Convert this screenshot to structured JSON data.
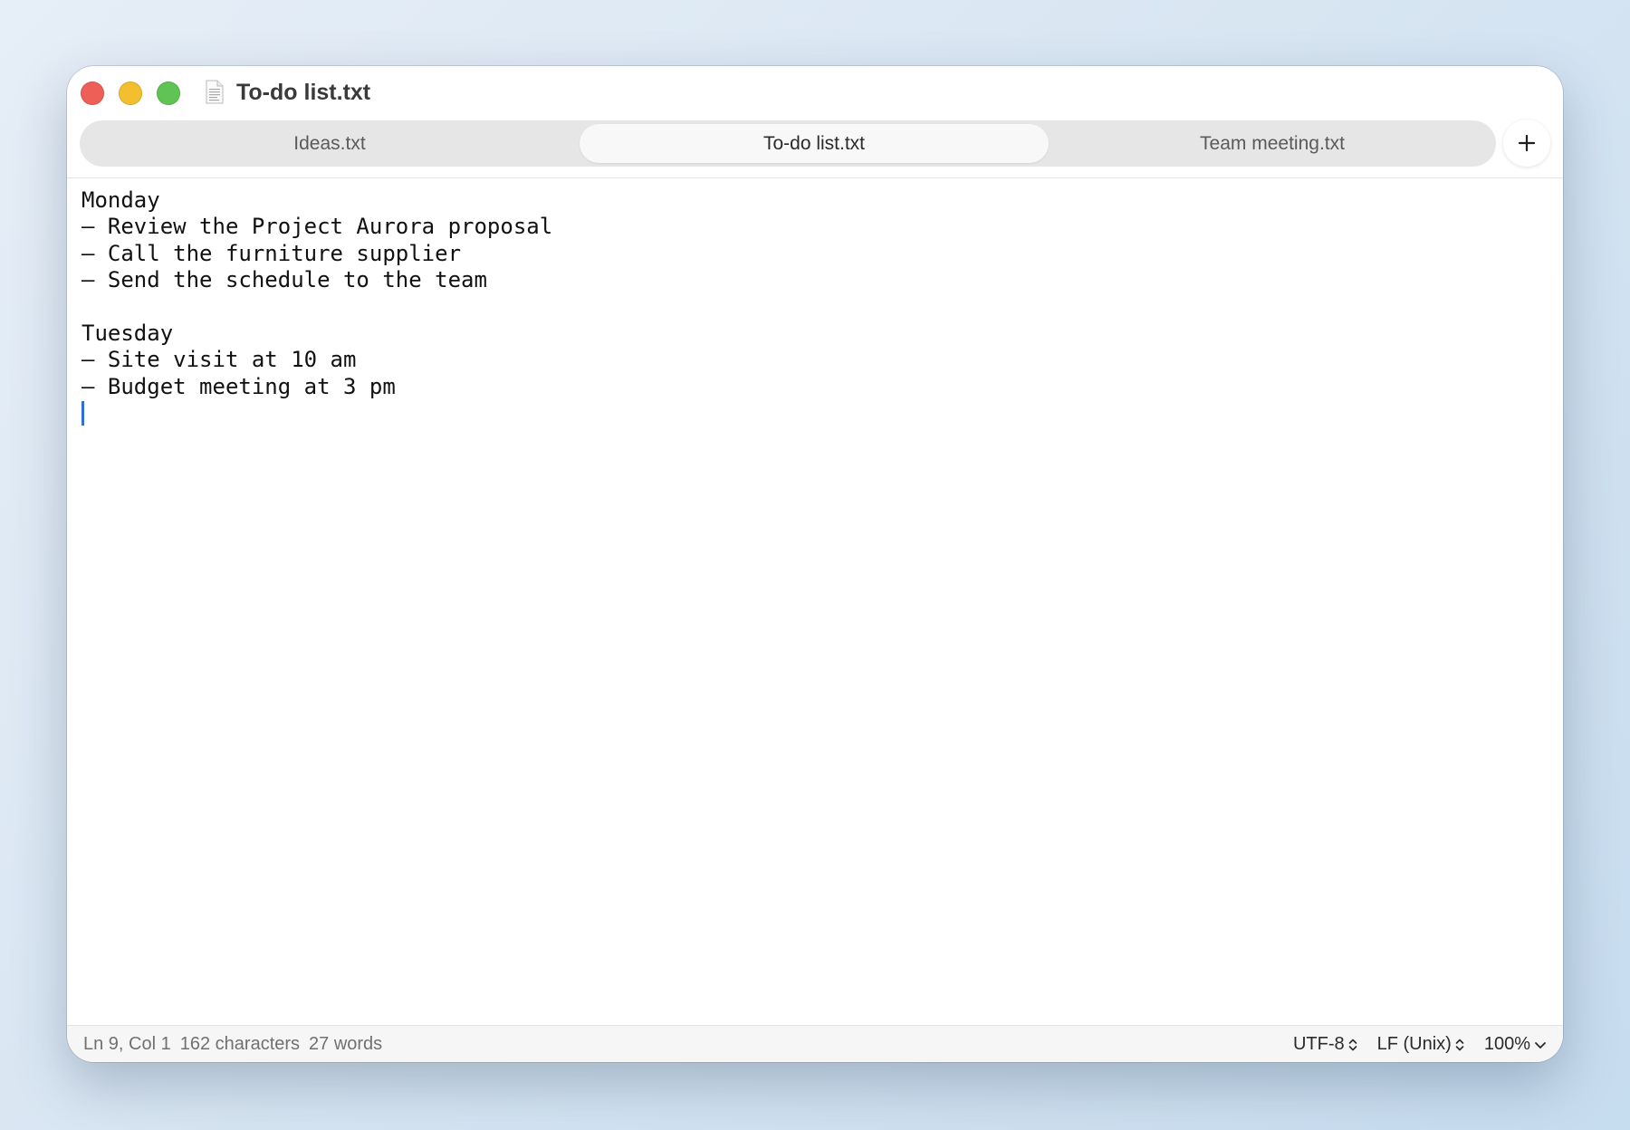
{
  "window": {
    "title": "To-do list.txt"
  },
  "tabs": [
    {
      "label": "Ideas.txt",
      "active": false
    },
    {
      "label": "To-do list.txt",
      "active": true
    },
    {
      "label": "Team meeting.txt",
      "active": false
    }
  ],
  "toolbar": {
    "new_tab_icon": "plus-icon"
  },
  "editor": {
    "lines": [
      "Monday",
      "– Review the Project Aurora proposal",
      "– Call the furniture supplier",
      "– Send the schedule to the team",
      "",
      "Tuesday",
      "– Site visit at 10 am",
      "– Budget meeting at 3 pm",
      ""
    ],
    "caret_color": "#2f6de0"
  },
  "status": {
    "position": "Ln 9, Col 1",
    "characters": "162 characters",
    "words": "27 words",
    "encoding": "UTF-8",
    "line_endings": "LF (Unix)",
    "zoom": "100%"
  },
  "colors": {
    "close": "#ee5f57",
    "minimize": "#f4bf2f",
    "maximize": "#5fc453"
  }
}
